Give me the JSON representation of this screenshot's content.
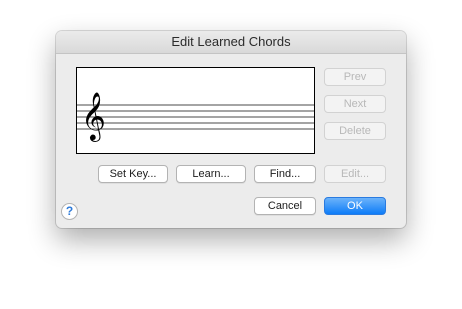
{
  "dialog": {
    "title": "Edit Learned Chords"
  },
  "staff": {
    "clef": "treble-clef-icon"
  },
  "side_buttons": {
    "prev": "Prev",
    "next": "Next",
    "delete": "Delete",
    "edit": "Edit..."
  },
  "action_buttons": {
    "set_key": "Set Key...",
    "learn": "Learn...",
    "find": "Find..."
  },
  "footer": {
    "help": "?",
    "cancel": "Cancel",
    "ok": "OK"
  },
  "colors": {
    "accent": "#0d7cf8",
    "dialog_bg": "#ececec",
    "help_text": "#2f7bd9"
  }
}
